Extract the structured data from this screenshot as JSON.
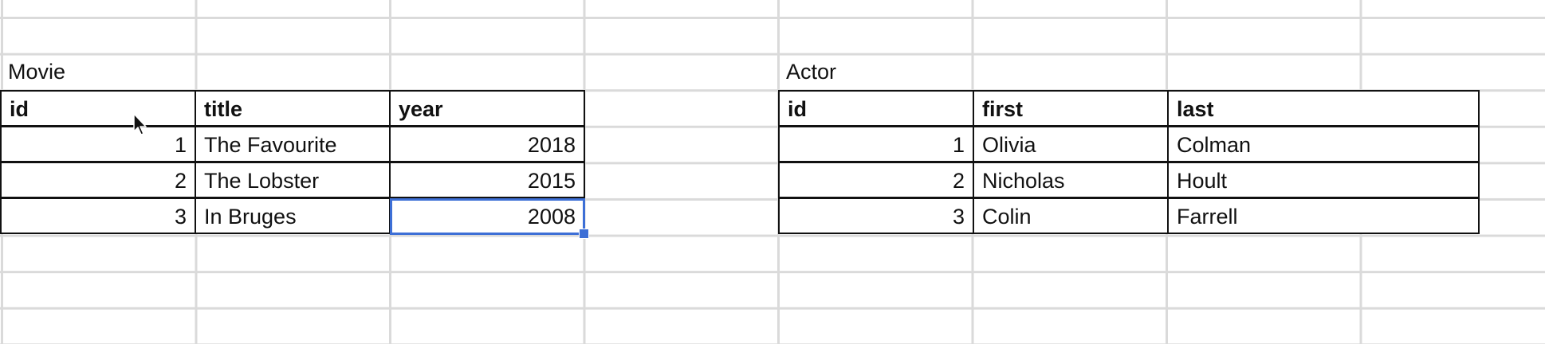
{
  "movie": {
    "label": "Movie",
    "headers": [
      "id",
      "title",
      "year"
    ],
    "rows": [
      [
        "1",
        "The Favourite",
        "2018"
      ],
      [
        "2",
        "The Lobster",
        "2015"
      ],
      [
        "3",
        "In Bruges",
        "2008"
      ]
    ]
  },
  "actor": {
    "label": "Actor",
    "headers": [
      "id",
      "first",
      "last"
    ],
    "rows": [
      [
        "1",
        "Olivia",
        "Colman"
      ],
      [
        "2",
        "Nicholas",
        "Hoult"
      ],
      [
        "3",
        "Colin",
        "Farrell"
      ]
    ]
  },
  "selection": {
    "table": "movie",
    "row": 2,
    "column": 2
  },
  "icons": {
    "pointer": "mouse-pointer-icon"
  },
  "colors": {
    "selection": "#3d6fd6",
    "gridline": "#dadada",
    "border": "#111111"
  }
}
